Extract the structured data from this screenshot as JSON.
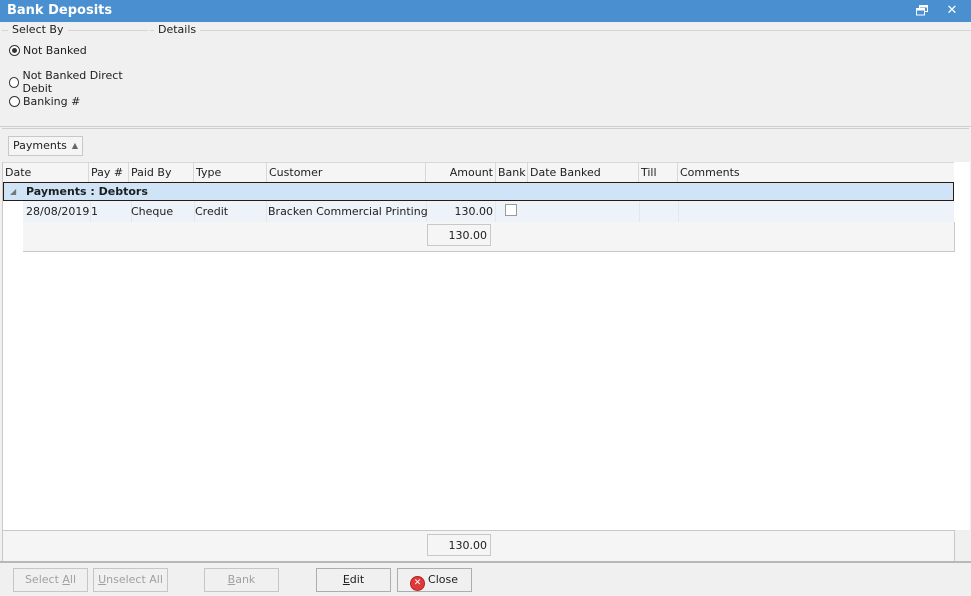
{
  "window": {
    "title": "Bank Deposits",
    "restore_icon": "restore-window-icon",
    "close_icon": "close-icon",
    "close_glyph": "✕"
  },
  "select_by": {
    "legend": "Select By",
    "options": [
      {
        "label": "Not Banked",
        "selected": true
      },
      {
        "label": "Not Banked Direct Debit",
        "selected": false
      },
      {
        "label": "Banking #",
        "selected": false
      }
    ]
  },
  "details": {
    "legend": "Details"
  },
  "group_panel": {
    "chip_label": "Payments",
    "sort_glyph": "▲"
  },
  "grid": {
    "columns": [
      "Date",
      "Pay #",
      "Paid By",
      "Type",
      "Customer",
      "Amount",
      "Bank",
      "Date Banked",
      "Till",
      "Comments"
    ],
    "group": {
      "expand_glyph": "◢",
      "label": "Payments : Debtors"
    },
    "rows": [
      {
        "date": "28/08/2019",
        "pay_no": "1",
        "paid_by": "Cheque",
        "type": "Credit",
        "customer": "Bracken Commercial Printing",
        "amount": "130.00",
        "bank": false,
        "date_banked": "",
        "till": "",
        "comments": ""
      }
    ],
    "group_total": "130.00",
    "grand_total": "130.00"
  },
  "buttons": {
    "select_all": {
      "pre": "Select ",
      "ul": "A",
      "post": "ll"
    },
    "unselect_all": {
      "pre": "",
      "ul": "U",
      "post": "nselect All"
    },
    "bank": {
      "pre": "",
      "ul": "B",
      "post": "ank"
    },
    "edit": {
      "pre": "",
      "ul": "E",
      "post": "dit"
    },
    "close": {
      "label": "Close",
      "icon_glyph": "✕"
    }
  },
  "colors": {
    "titlebar": "#4a8fcf",
    "group_row": "#cfe4f7",
    "data_row": "#eef3f9",
    "close_icon": "#e0393a"
  }
}
